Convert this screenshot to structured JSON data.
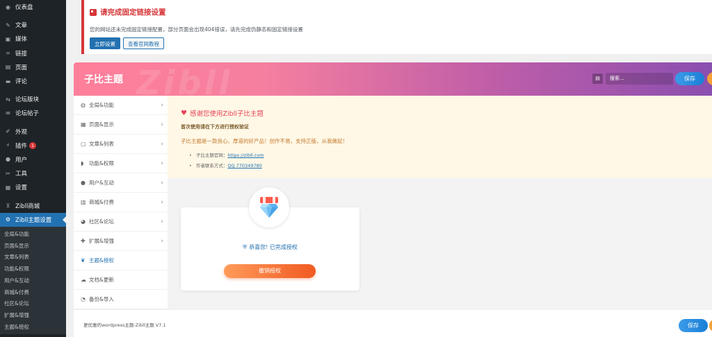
{
  "wp_menu": {
    "items": [
      {
        "label": "仪表盘",
        "icon": "dashboard-icon"
      },
      {
        "label": "文章",
        "icon": "pin-icon"
      },
      {
        "label": "媒体",
        "icon": "media-icon"
      },
      {
        "label": "链接",
        "icon": "link-icon"
      },
      {
        "label": "页面",
        "icon": "page-icon"
      },
      {
        "label": "评论",
        "icon": "comment-icon"
      },
      {
        "label": "论坛版块",
        "icon": "forum-icon"
      },
      {
        "label": "论坛帖子",
        "icon": "forum-post-icon"
      },
      {
        "label": "外观",
        "icon": "brush-icon"
      },
      {
        "label": "插件",
        "icon": "plugin-icon",
        "badge": "1"
      },
      {
        "label": "用户",
        "icon": "user-icon"
      },
      {
        "label": "工具",
        "icon": "wrench-icon"
      },
      {
        "label": "设置",
        "icon": "settings-icon"
      },
      {
        "label": "Zibll商城",
        "icon": "cart-icon"
      },
      {
        "label": "Zibll主题设置",
        "icon": "gear-icon"
      }
    ],
    "submenu": [
      "全局&功能",
      "页面&显示",
      "文章&列表",
      "功能&权限",
      "用户&互动",
      "商城&付费",
      "社区&论坛",
      "扩展&增强",
      "主题&授权"
    ]
  },
  "notice": {
    "title": "请完成固定链接设置",
    "desc": "您的网站还未完成固定链接配置，部分页面会出现404错误，请先完成伪静态和固定链接设置",
    "btn_primary": "立即设置",
    "btn_secondary": "查看官网教程"
  },
  "header": {
    "brand": "子比主题",
    "watermark": "Zibll",
    "search_placeholder": "搜索...",
    "save_label": "保存"
  },
  "nav": {
    "items": [
      {
        "label": "全局&功能",
        "icon": "globe-icon"
      },
      {
        "label": "页面&显示",
        "icon": "calendar-icon"
      },
      {
        "label": "文章&列表",
        "icon": "document-icon"
      },
      {
        "label": "功能&权限",
        "icon": "shield-icon"
      },
      {
        "label": "用户&互动",
        "icon": "user-icon"
      },
      {
        "label": "商城&付费",
        "icon": "shop-icon"
      },
      {
        "label": "社区&论坛",
        "icon": "community-icon"
      },
      {
        "label": "扩展&增强",
        "icon": "extension-icon"
      },
      {
        "label": "主题&授权",
        "icon": "theme-icon"
      },
      {
        "label": "文档&更新",
        "icon": "cloud-icon"
      },
      {
        "label": "备份&导入",
        "icon": "backup-icon"
      }
    ]
  },
  "welcome": {
    "title": "感谢您使用Zibll子比主题",
    "line1": "首次使用请在下方进行授权验证",
    "line2": "子比主题是一款良心、厚道的好产品！创作不易，支持正版，从我做起！",
    "official_label": "子比主题官网：",
    "official_link": "https://zibll.com",
    "contact_label": "作者联系方式：",
    "contact_link": "QQ 770349780"
  },
  "auth": {
    "status": "恭喜您! 已完成授权",
    "revoke_label": "撤销授权"
  },
  "footer": {
    "text": "更优雅的wordpress主题-Zibll主题 V7.1",
    "save_label": "保存"
  },
  "colors": {
    "wp_sidebar": "#1d2327",
    "wp_active": "#2271b1",
    "notice_red": "#d63638",
    "banner_start": "#ff7f9a",
    "banner_end": "#8a4fb0",
    "revoke_orange": "#f05a22"
  }
}
